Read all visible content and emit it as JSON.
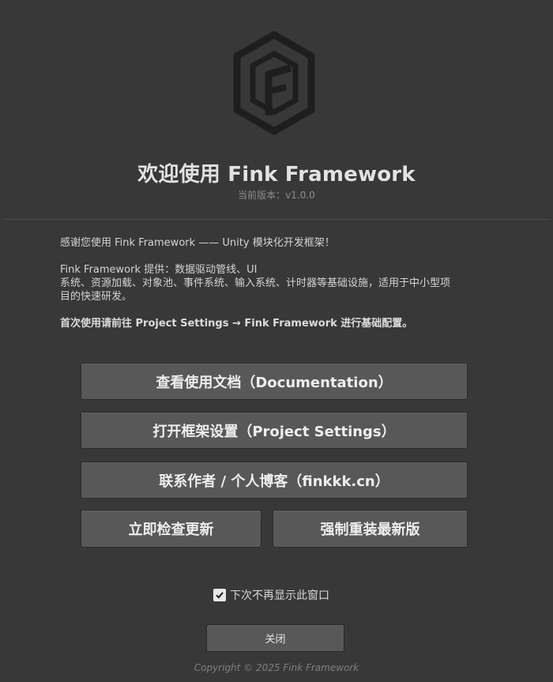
{
  "header": {
    "logo_icon": "fink-framework-hexagon-logo",
    "title": "欢迎使用 Fink Framework",
    "version": "当前版本：v1.0.0"
  },
  "description": {
    "line1": "感谢您使用 Fink Framework —— Unity 模块化开发框架！",
    "line2a": "Fink Framework 提供：数据驱动管线、UI",
    "line2b": "系统、资源加载、对象池、事件系统、输入系统、计时器等基础设施，适用于中小型项",
    "line2c": "目的快速研发。",
    "line3": "首次使用请前往 Project Settings → Fink Framework 进行基础配置。"
  },
  "buttons": {
    "documentation": "查看使用文档（Documentation）",
    "project_settings": "打开框架设置（Project Settings）",
    "contact": "联系作者 / 个人博客（finkkk.cn）",
    "check_update": "立即检查更新",
    "force_reinstall": "强制重装最新版"
  },
  "footer": {
    "dont_show_checked": true,
    "dont_show_label": "下次不再显示此窗口",
    "close_label": "关闭",
    "copyright": "Copyright © 2025 Fink Framework"
  },
  "colors": {
    "background": "#383838",
    "button": "#585858",
    "logo": "#1e1e1e"
  }
}
